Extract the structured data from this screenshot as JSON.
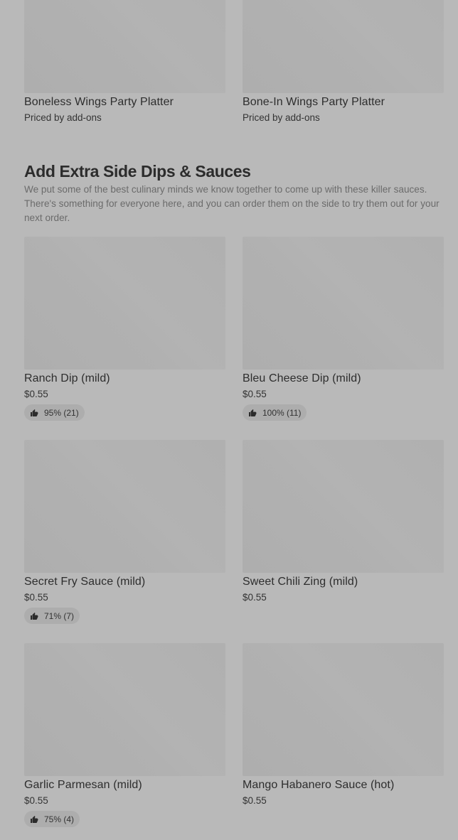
{
  "top_items": [
    {
      "name": "Boneless Wings Party Platter",
      "price": "Priced by add-ons"
    },
    {
      "name": "Bone-In Wings Party Platter",
      "price": "Priced by add-ons"
    }
  ],
  "section": {
    "title": "Add Extra Side Dips & Sauces",
    "description": "We put some of the best culinary minds we know together to come up with these killer sauces. There's something for everyone here, and you can order them on the side to try them out for your next order."
  },
  "items": [
    {
      "name": "Ranch Dip (mild)",
      "price": "$0.55",
      "rating": "95% (21)"
    },
    {
      "name": "Bleu Cheese Dip (mild)",
      "price": "$0.55",
      "rating": "100% (11)"
    },
    {
      "name": "Secret Fry Sauce (mild)",
      "price": "$0.55",
      "rating": "71% (7)"
    },
    {
      "name": "Sweet Chili Zing (mild)",
      "price": "$0.55",
      "rating": null
    },
    {
      "name": "Garlic Parmesan (mild)",
      "price": "$0.55",
      "rating": "75% (4)"
    },
    {
      "name": "Mango Habanero Sauce (hot)",
      "price": "$0.55",
      "rating": null
    }
  ],
  "icons": {
    "rating": "thumbs-up-icon"
  }
}
